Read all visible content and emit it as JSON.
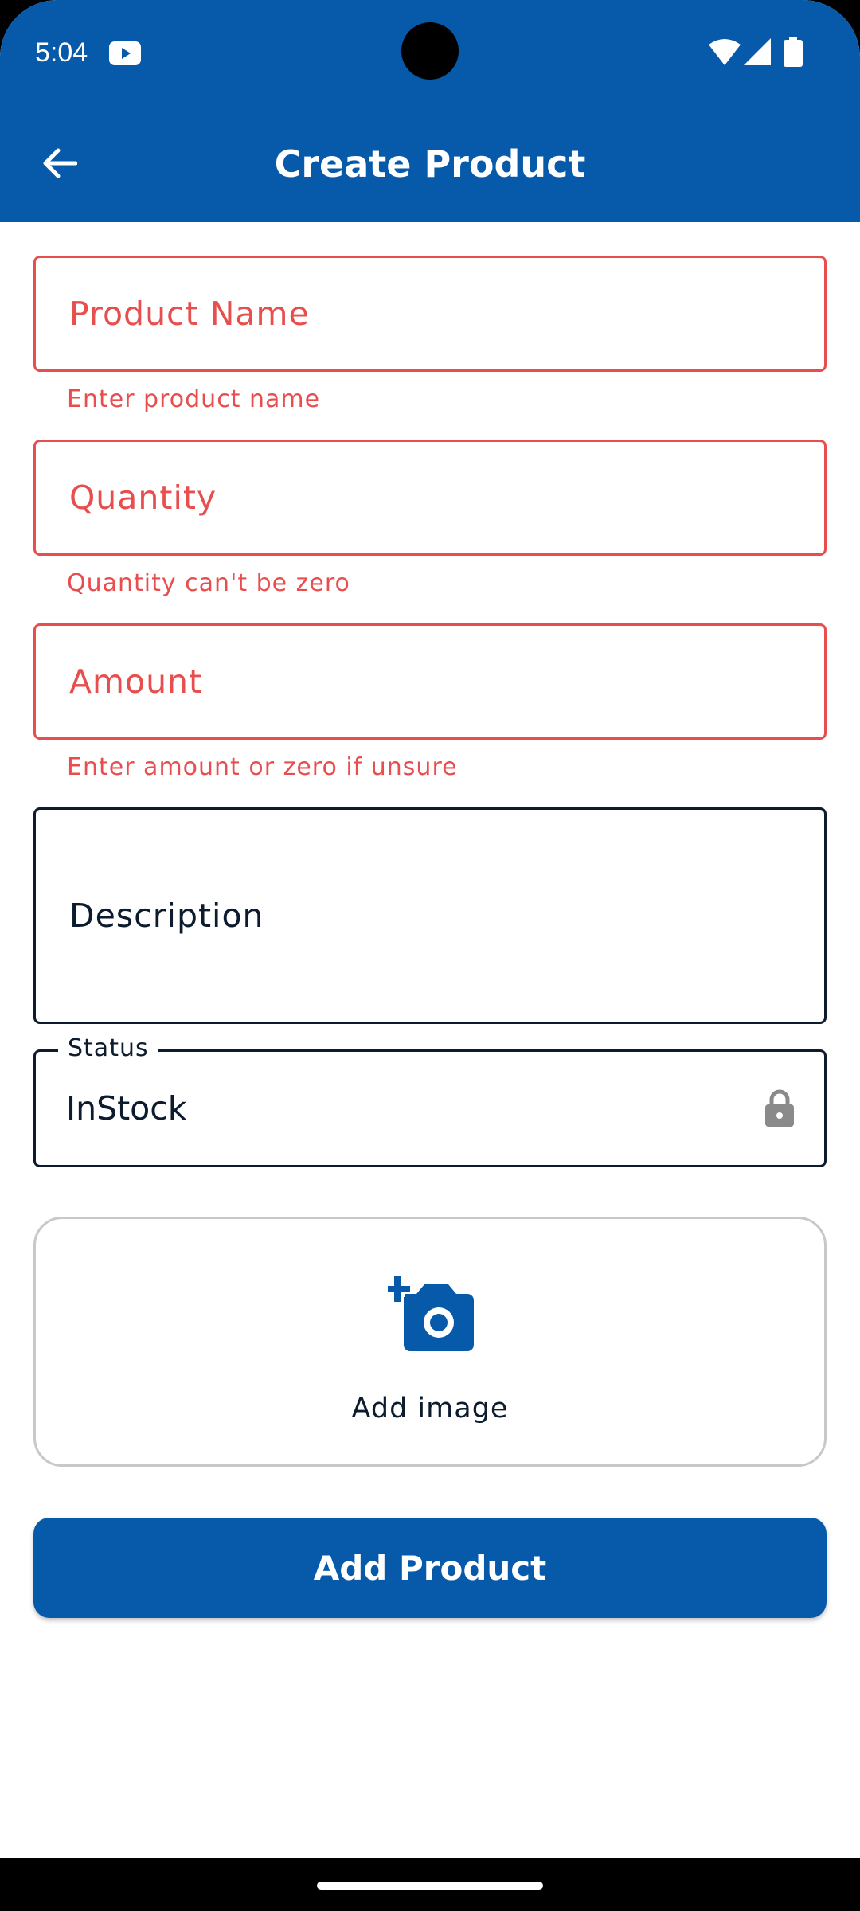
{
  "status_bar": {
    "time": "5:04",
    "icons": [
      "youtube-icon",
      "wifi-icon",
      "signal-icon",
      "battery-icon"
    ]
  },
  "app_bar": {
    "title": "Create Product",
    "back_icon": "arrow-back-icon"
  },
  "form": {
    "product_name": {
      "placeholder": "Product Name",
      "error": "Enter product name"
    },
    "quantity": {
      "placeholder": "Quantity",
      "error": "Quantity can't be zero"
    },
    "amount": {
      "placeholder": "Amount",
      "error": "Enter amount or zero if unsure"
    },
    "description": {
      "placeholder": "Description"
    },
    "status": {
      "label": "Status",
      "value": "InStock",
      "icon": "lock-icon"
    }
  },
  "image_picker": {
    "label": "Add image",
    "icon": "add-photo-icon"
  },
  "submit": {
    "label": "Add Product"
  },
  "colors": {
    "primary": "#075aaa",
    "error": "#e84e4e",
    "text": "#0d1b2e"
  }
}
